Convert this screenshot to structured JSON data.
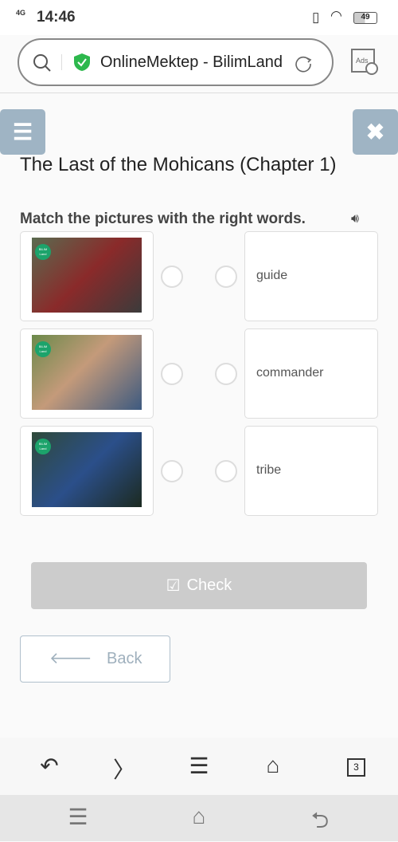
{
  "status_bar": {
    "network": "4G",
    "time": "14:46",
    "battery": "49"
  },
  "browser": {
    "page_title": "OnlineMektep - BilimLand",
    "ads_label": "Ads",
    "tab_count": "3"
  },
  "page": {
    "title": "The Last of the Mohicans (Chapter 1)",
    "instruction": "Match the pictures with the right words.",
    "picture_logo": "BILIM Land",
    "words": [
      "guide",
      "commander",
      "tribe"
    ],
    "check_label": "Check",
    "back_label": "Back"
  },
  "colors": {
    "accent": "#9fb4c4",
    "disabled_button": "#cccccc",
    "shield": "#2db84d",
    "logo": "#1ca36b"
  }
}
